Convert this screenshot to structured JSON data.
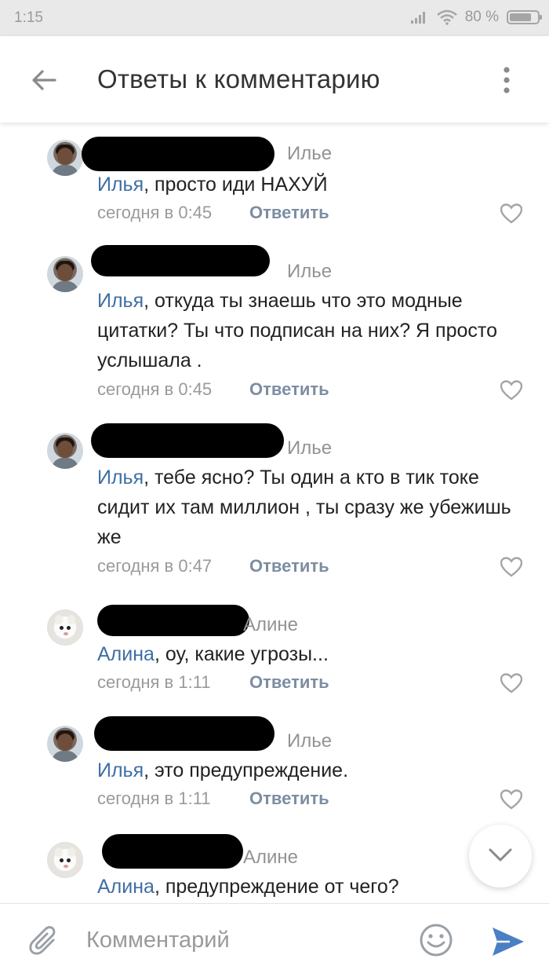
{
  "statusbar": {
    "time": "1:15",
    "battery": "80 %",
    "battery_level": 0.8
  },
  "header": {
    "title": "Ответы к комментарию"
  },
  "comments": [
    {
      "avatar": "boy-avatar",
      "reply_to": "Илье",
      "mention": "Илья",
      "text": ", просто иди НАХУЙ",
      "time": "сегодня в 0:45",
      "reply": "Ответить"
    },
    {
      "avatar": "boy-avatar",
      "reply_to": "Илье",
      "mention": "Илья",
      "text": ", откуда ты знаешь что это модные цитатки? Ты что подписан на них? Я просто услышала .",
      "time": "сегодня в 0:45",
      "reply": "Ответить"
    },
    {
      "avatar": "boy-avatar",
      "reply_to": "Илье",
      "mention": "Илья",
      "text": ", тебе ясно? Ты один а кто в тик токе сидит их там миллион , ты сразу же убежишь же",
      "time": "сегодня в 0:47",
      "reply": "Ответить"
    },
    {
      "avatar": "cat-avatar",
      "reply_to": "Алине",
      "mention": "Алина",
      "text": ", оу, какие угрозы...",
      "time": "сегодня в 1:11",
      "reply": "Ответить"
    },
    {
      "avatar": "boy-avatar",
      "reply_to": "Илье",
      "mention": "Илья",
      "text": ", это предупреждение.",
      "time": "сегодня в 1:11",
      "reply": "Ответить"
    },
    {
      "avatar": "cat-avatar",
      "reply_to": "Алине",
      "mention": "Алина",
      "text": ", предупреждение от чего?"
    }
  ],
  "composer": {
    "placeholder": "Комментарий"
  },
  "colors": {
    "accent": "#4a7fc4",
    "mention": "#3f6fa3",
    "reply_button": "#7d8da2",
    "muted": "#9a9a9a"
  }
}
